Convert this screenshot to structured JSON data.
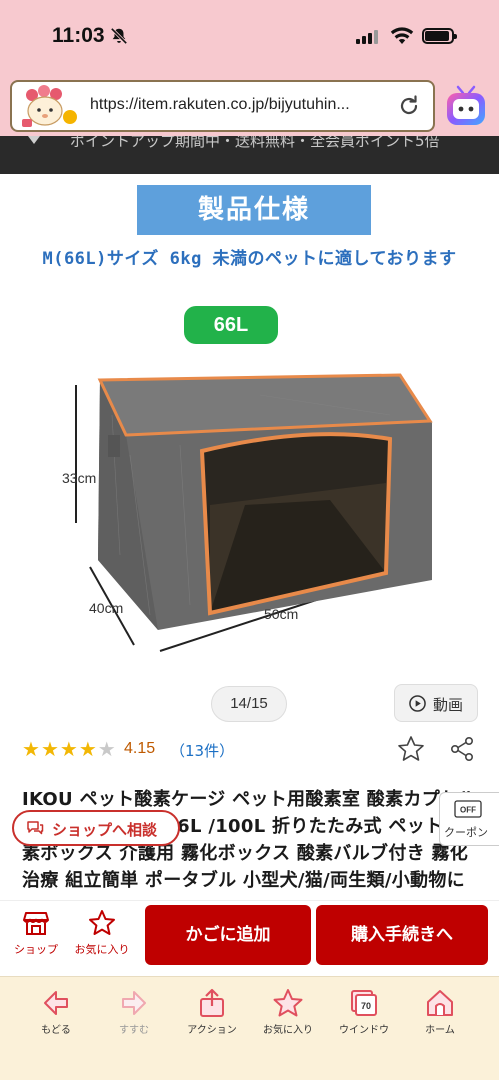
{
  "status_bar": {
    "time": "11:03"
  },
  "browser": {
    "url": "https://item.rakuten.co.jp/bijyutuhin...",
    "banner_text": "ポイントアップ期間中・送料無料・全会員ポイント5倍"
  },
  "product_image": {
    "spec_heading": "製品仕様",
    "spec_subtitle": "M(66L)サイズ 6kg 未満のペットに適しております",
    "size_badge": "66L",
    "dim_height": "33cm",
    "dim_depth": "40cm",
    "dim_width": "50cm",
    "counter": "14/15",
    "video_label": "動画"
  },
  "rating": {
    "score": 4.15,
    "score_text": "4.15",
    "count_text": "（13件）",
    "stars_filled": 4,
    "stars_total": 5
  },
  "product": {
    "title": "IKOU ペット酸素ケージ ペット用酸素室 酸素カプセル 酸素発生器 22L/66L /100L 折りたたみ式 ペット 酸素ボックス 介護用 霧化ボックス 酸素バルブ付き 霧化治療 組立簡単 ポータブル 小型犬/猫/両生類/小動物に適用 防水材質",
    "consult_label": "ショップへ相談",
    "coupon_label": "クーポン",
    "coupon_tag": "OFF"
  },
  "action_bar": {
    "shop_label": "ショップ",
    "favorite_label": "お気に入り",
    "cart_label": "かごに追加",
    "buy_label": "購入手続きへ"
  },
  "browser_toolbar": {
    "back_label": "もどる",
    "forward_label": "すすむ",
    "action_label": "アクション",
    "favorites_label": "お気に入り",
    "window_label": "ウインドウ",
    "window_count": "70",
    "home_label": "ホーム"
  },
  "colors": {
    "rakuten_red": "#bf0000",
    "top_pink": "#f7c9cf",
    "toolbar_cream": "#fbf1d9",
    "spec_blue": "#5ea0dc",
    "badge_green": "#22b24a"
  }
}
